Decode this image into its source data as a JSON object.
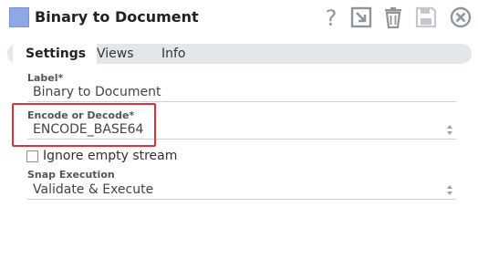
{
  "header": {
    "title": "Binary to Document",
    "icons": [
      "help-icon",
      "export-icon",
      "delete-icon",
      "save-icon",
      "close-icon"
    ]
  },
  "tabs": [
    {
      "label": "Settings",
      "active": true
    },
    {
      "label": "Views",
      "active": false
    },
    {
      "label": "Info",
      "active": false
    }
  ],
  "fields": {
    "label": {
      "label": "Label*",
      "value": "Binary to Document"
    },
    "encode_decode": {
      "label": "Encode or Decode*",
      "value": "ENCODE_BASE64"
    },
    "ignore_empty": {
      "label": "Ignore empty stream",
      "checked": false
    },
    "snap_execution": {
      "label": "Snap Execution",
      "value": "Validate & Execute"
    }
  },
  "colors": {
    "snap_icon": "#8ea7e6",
    "highlight": "#e0303a",
    "icon_gray": "#8f959c"
  }
}
